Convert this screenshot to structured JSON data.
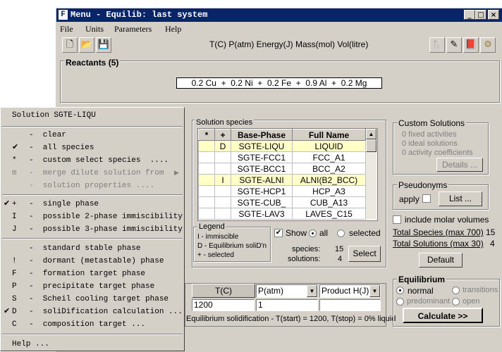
{
  "window": {
    "title": "Menu - Equilib: last system",
    "app_icon": "F",
    "controls": [
      "_",
      "□",
      "×"
    ]
  },
  "menubar": [
    "File",
    "Units",
    "Parameters",
    "Help"
  ],
  "toolbar": {
    "units_text": "T(C) P(atm) Energy(J) Mass(mol) Vol(litre)",
    "left_icons": [
      "new-file-icon",
      "open-folder-icon",
      "save-disk-icon"
    ],
    "right_icons": [
      "fork-knife-icon",
      "edit-list-icon",
      "book-icon",
      "settings-figure-icon"
    ]
  },
  "reactants": {
    "label": "Reactants  (5)",
    "formula": "0.2 Cu  +  0.2 Ni  +  0.2 Fe  +  0.9 Al  +  0.2 Mg"
  },
  "solution_species": {
    "label": "Solution species",
    "headers": [
      "*",
      "+",
      "Base-Phase",
      "Full Name"
    ],
    "rows": [
      {
        "star": "",
        "plus": "D",
        "base": "SGTE-LIQU",
        "full": "LIQUID",
        "highlight": true
      },
      {
        "star": "",
        "plus": "",
        "base": "SGTE-FCC1",
        "full": "FCC_A1",
        "highlight": false
      },
      {
        "star": "",
        "plus": "",
        "base": "SGTE-BCC1",
        "full": "BCC_A2",
        "highlight": false
      },
      {
        "star": "",
        "plus": "I",
        "base": "SGTE-ALNI",
        "full": "ALNI(B2_BCC)",
        "highlight": true
      },
      {
        "star": "",
        "plus": "",
        "base": "SGTE-HCP1",
        "full": "HCP_A3",
        "highlight": false
      },
      {
        "star": "",
        "plus": "",
        "base": "SGTE-CUB_",
        "full": "CUB_A13",
        "highlight": false
      },
      {
        "star": "",
        "plus": "",
        "base": "SGTE-LAV3",
        "full": "LAVES_C15",
        "highlight": false
      }
    ],
    "legend_title": "Legend",
    "legend": [
      "I - immiscible",
      "D - Equilibrium soliD'n",
      "+ - selected"
    ],
    "show_label": "Show",
    "show_all": "all",
    "show_selected": "selected",
    "species_label": "species:",
    "species_count": "15",
    "solutions_label": "solutions:",
    "solutions_count": "4",
    "select_button": "Select"
  },
  "custom_solutions": {
    "label": "Custom Solutions",
    "lines": [
      "0  fixed activities",
      "0  ideal solutions",
      "0  activity coefficients"
    ],
    "details_button": "Details ..."
  },
  "pseudonyms": {
    "label": "Pseudonyms",
    "apply_label": "apply",
    "list_button": "List ..."
  },
  "molar_volumes": {
    "label": "include molar volumes"
  },
  "totals": {
    "species_label": "Total Species (max 700)",
    "species_value": "15",
    "solutions_label": "Total Solutions (max 30)",
    "solutions_value": "4"
  },
  "default_button": "Default",
  "final_conditions": {
    "col_t": "T(C)",
    "col_p": "P(atm)",
    "col_h": "Product H(J)",
    "t_value": "1200",
    "p_value": "1",
    "h_value": "",
    "status": "Equilibrium solidification - T(start) = 1200, T(stop) = 0% liquid"
  },
  "equilibrium": {
    "label": "Equilibrium",
    "normal": "normal",
    "transitions": "transitions",
    "predominant": "predominant",
    "open": "open",
    "calculate_button": "Calculate >>"
  },
  "popup": {
    "title": "Solution SGTE-LIQU",
    "items": [
      {
        "check": "",
        "key": "",
        "text": "-  clear",
        "disabled": false
      },
      {
        "check": "✔",
        "key": "",
        "text": "-  all species",
        "disabled": false
      },
      {
        "check": "",
        "key": "*",
        "text": "-  custom select species  ....",
        "disabled": false
      },
      {
        "check": "",
        "key": "m",
        "text": "-  merge dilute solution from",
        "disabled": true,
        "submenu": true
      },
      {
        "check": "",
        "key": "",
        "text": "-  solution properties ....",
        "disabled": true
      },
      {
        "check": "✔",
        "key": "+",
        "text": "-  single phase",
        "disabled": false
      },
      {
        "check": "",
        "key": "I",
        "text": "-  possible 2-phase immiscibility",
        "disabled": false
      },
      {
        "check": "",
        "key": "J",
        "text": "-  possible 3-phase immiscibility",
        "disabled": false
      },
      {
        "check": "",
        "key": "",
        "text": "-  standard stable phase",
        "disabled": false
      },
      {
        "check": "",
        "key": "!",
        "text": "-  dormant (metastable) phase",
        "disabled": false
      },
      {
        "check": "",
        "key": "F",
        "text": "-  formation target phase",
        "disabled": false
      },
      {
        "check": "",
        "key": "P",
        "text": "-  precipitate target phase",
        "disabled": false
      },
      {
        "check": "",
        "key": "S",
        "text": "-  Scheil cooling target phase",
        "disabled": false
      },
      {
        "check": "✔",
        "key": "D",
        "text": "-  soliDification calculation ...",
        "disabled": false
      },
      {
        "check": "",
        "key": "C",
        "text": "-  composition target ...",
        "disabled": false
      },
      {
        "check": "",
        "key": "",
        "text": "Help ...",
        "disabled": false
      }
    ]
  }
}
